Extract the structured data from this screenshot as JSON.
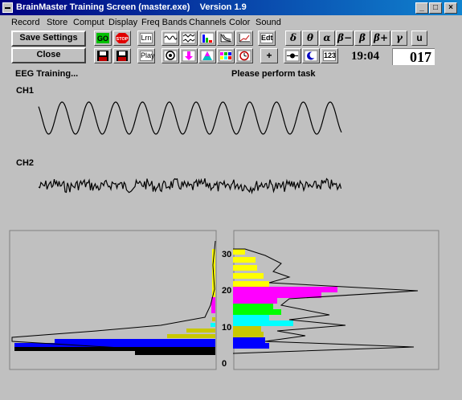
{
  "window": {
    "title": "BrainMaster Training Screen (master.exe)    Version 1.9",
    "caption_buttons": [
      "minimize-icon",
      "maximize-icon",
      "close-icon"
    ]
  },
  "menu": [
    "Record",
    "Store",
    "Comput",
    "Display",
    "Freq Bands",
    "Channels",
    "Color",
    "Sound"
  ],
  "buttons": {
    "save_settings": "Save Settings",
    "close": "Close",
    "go": "GO",
    "stop": "STOP",
    "lrn": "Lrn",
    "play": "Play",
    "edit": "Edt",
    "plus": "+",
    "num": "123"
  },
  "bands": [
    "δ",
    "θ",
    "α",
    "β−",
    "β",
    "β+",
    "γ",
    "u"
  ],
  "status": {
    "time": "19:04",
    "counter": "017",
    "mode": "EEG Training...",
    "message": "Please perform task"
  },
  "channels": [
    "CH1",
    "CH2"
  ],
  "spectrum": {
    "y_ticks": [
      "30",
      "20",
      "10",
      "0"
    ],
    "colors": {
      "yellow": "#ffff00",
      "magenta": "#ff00ff",
      "green": "#00ff00",
      "cyan": "#00ffff",
      "olive": "#c8c800",
      "blue": "#0000ff",
      "black": "#000000"
    }
  }
}
